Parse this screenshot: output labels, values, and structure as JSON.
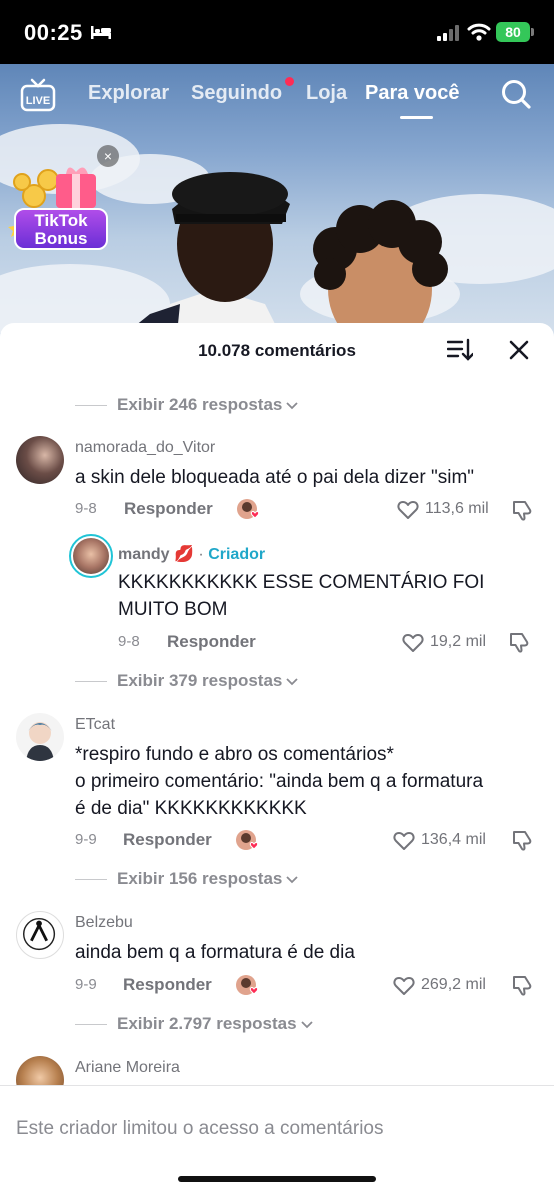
{
  "status_bar": {
    "time": "00:25",
    "battery": "80"
  },
  "nav": {
    "tabs": [
      "Explorar",
      "Seguindo",
      "Loja",
      "Para você"
    ],
    "active_tab": "Para você",
    "live_label": "LIVE"
  },
  "bonus": {
    "line1": "TikTok",
    "line2": "Bonus",
    "close": "×"
  },
  "sheet": {
    "title": "10.078 comentários"
  },
  "comments": [
    {
      "pre_replies": "Exibir 246 respostas",
      "username": "namorada_do_Vitor",
      "text": "a skin dele bloqueada até o pai dela dizer \"sim\"",
      "date": "9-8",
      "reply_label": "Responder",
      "likes": "113,6 mil"
    },
    {
      "username": "mandy",
      "emoji": "💋",
      "creator_label": "Criador",
      "separator": "·",
      "text": "KKKKKKKKKKK ESSE COMENTÁRIO FOI MUITO BOM",
      "date": "9-8",
      "reply_label": "Responder",
      "likes": "19,2 mil"
    },
    {
      "pre_replies": "Exibir 379 respostas",
      "username": "ETcat",
      "text_lines": [
        "*respiro fundo e abro os comentários*",
        "o primeiro comentário: \"ainda bem q a formatura",
        "é de dia\" KKKKKKKKKKKK"
      ],
      "date": "9-9",
      "reply_label": "Responder",
      "likes": "136,4 mil"
    },
    {
      "pre_replies": "Exibir 156 respostas",
      "username": "Belzebu",
      "text": "ainda bem q a formatura é de dia",
      "date": "9-9",
      "reply_label": "Responder",
      "likes": "269,2 mil"
    },
    {
      "pre_replies": "Exibir 2.797 respostas",
      "username": "Ariane Moreira"
    }
  ],
  "footer": {
    "text": "Este criador limitou o acesso a comentários"
  },
  "colors": {
    "accent": "#fe2c55",
    "creator": "#20a7c9",
    "battery": "#34c759"
  }
}
